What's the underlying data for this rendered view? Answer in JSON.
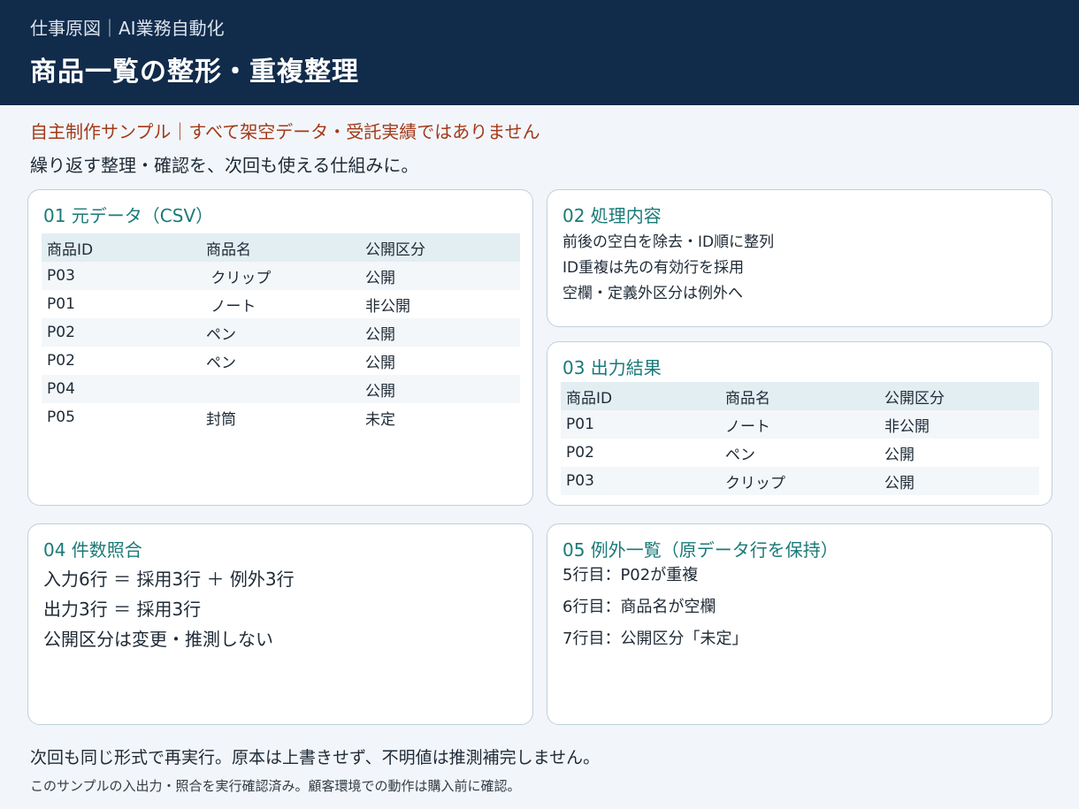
{
  "header": {
    "subtitle": "仕事原図｜AI業務自動化",
    "title": "商品一覧の整形・重複整理"
  },
  "notice": "自主制作サンプル｜すべて架空データ・受託実績ではありません",
  "tagline": "繰り返す整理・確認を、次回も使える仕組みに。",
  "colors": {
    "header_bg": "#112b4b",
    "accent": "#1a7a78",
    "notice": "#a33a1a",
    "page_bg": "#f2f6fa",
    "table_header_bg": "#e3eef3"
  },
  "source_card": {
    "title": "01 元データ（CSV）",
    "columns": [
      "商品ID",
      "商品名",
      "公開区分"
    ],
    "rows": [
      [
        "P03",
        " クリップ",
        "公開"
      ],
      [
        "P01",
        " ノート",
        "非公開"
      ],
      [
        "P02",
        "ペン",
        "公開"
      ],
      [
        "P02",
        "ペン",
        "公開"
      ],
      [
        "P04",
        "",
        "公開"
      ],
      [
        "P05",
        "封筒",
        "未定"
      ]
    ]
  },
  "process_card": {
    "title": "02 処理内容",
    "lines": [
      "前後の空白を除去・ID順に整列",
      "ID重複は先の有効行を採用",
      "空欄・定義外区分は例外へ"
    ]
  },
  "output_card": {
    "title": "03 出力結果",
    "columns": [
      "商品ID",
      "商品名",
      "公開区分"
    ],
    "rows": [
      [
        "P01",
        "ノート",
        "非公開"
      ],
      [
        "P02",
        "ペン",
        "公開"
      ],
      [
        "P03",
        "クリップ",
        "公開"
      ]
    ]
  },
  "count_card": {
    "title": "04 件数照合",
    "lines": [
      "入力6行 ＝ 採用3行 ＋ 例外3行",
      "出力3行 ＝ 採用3行",
      "公開区分は変更・推測しない"
    ]
  },
  "exception_card": {
    "title": "05 例外一覧（原データ行を保持）",
    "lines": [
      "5行目：P02が重複",
      "6行目：商品名が空欄",
      "7行目：公開区分「未定」"
    ]
  },
  "footer": {
    "line1": "次回も同じ形式で再実行。原本は上書きせず、不明値は推測補完しません。",
    "line2": "このサンプルの入出力・照合を実行確認済み。顧客環境での動作は購入前に確認。"
  }
}
